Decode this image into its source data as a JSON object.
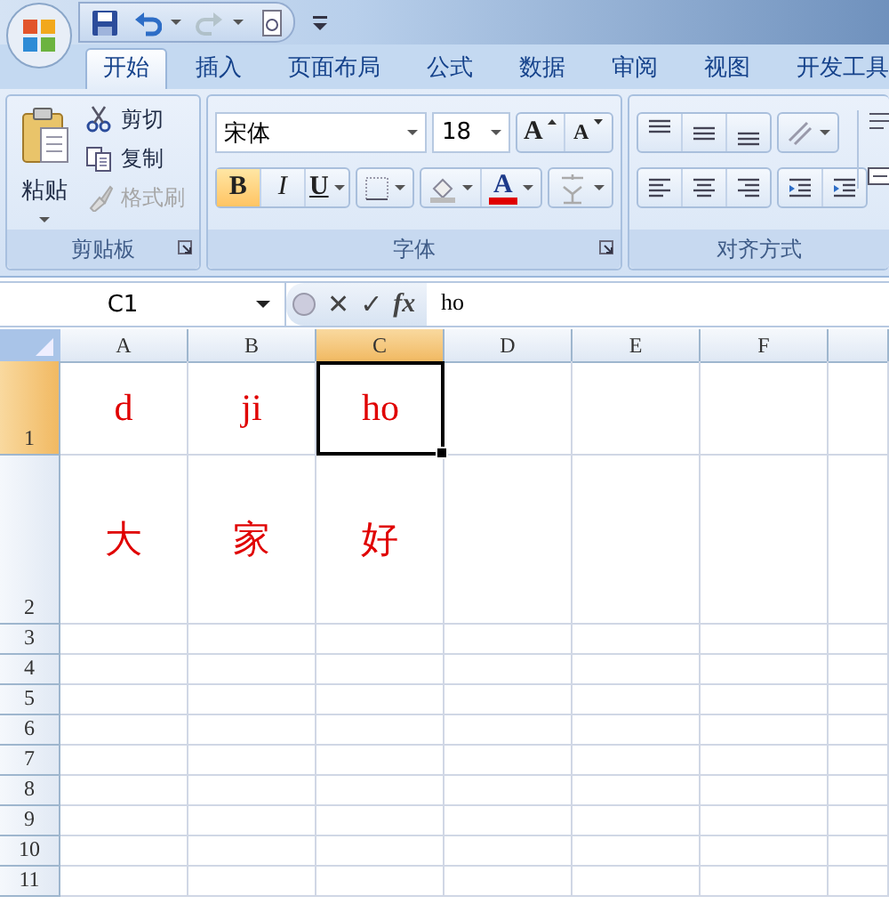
{
  "quick_access": [
    {
      "kind": "save",
      "disabled": false
    },
    {
      "kind": "undo",
      "disabled": false
    },
    {
      "kind": "redo",
      "disabled": true
    },
    {
      "kind": "preview",
      "disabled": false
    }
  ],
  "tabs": [
    {
      "label": "开始",
      "selected": true
    },
    {
      "label": "插入",
      "selected": false
    },
    {
      "label": "页面布局",
      "selected": false
    },
    {
      "label": "公式",
      "selected": false
    },
    {
      "label": "数据",
      "selected": false
    },
    {
      "label": "审阅",
      "selected": false
    },
    {
      "label": "视图",
      "selected": false
    },
    {
      "label": "开发工具",
      "selected": false
    }
  ],
  "clipboard": {
    "label": "剪贴板",
    "paste": "粘贴",
    "commands": [
      {
        "kind": "cut",
        "label": "剪切",
        "disabled": false
      },
      {
        "kind": "copy",
        "label": "复制",
        "disabled": false
      },
      {
        "kind": "brush",
        "label": "格式刷",
        "disabled": true
      }
    ]
  },
  "font": {
    "label": "字体",
    "name": "宋体",
    "size": "18",
    "grow": "A",
    "shrink": "A",
    "styles": [
      {
        "kind": "bold",
        "label": "B",
        "on": true
      },
      {
        "kind": "italic",
        "label": "I",
        "on": false
      },
      {
        "kind": "underline",
        "label": "U",
        "on": false
      }
    ],
    "font_color": "A"
  },
  "alignment": {
    "label": "对齐方式"
  },
  "formula_bar": {
    "name_box": "C1",
    "cancel": "✕",
    "enter": "✓",
    "function": "fx",
    "value": "ho"
  },
  "sheet": {
    "columns": [
      {
        "label": "A",
        "selected": false
      },
      {
        "label": "B",
        "selected": false
      },
      {
        "label": "C",
        "selected": true
      },
      {
        "label": "D",
        "selected": false
      },
      {
        "label": "E",
        "selected": false
      },
      {
        "label": "F",
        "selected": false
      }
    ],
    "rows": [
      {
        "label": "1",
        "selected": true,
        "cells": [
          {
            "text": "d",
            "selected": false
          },
          {
            "text": "ji",
            "selected": false
          },
          {
            "text": "ho",
            "selected": true
          }
        ]
      },
      {
        "label": "2",
        "selected": false,
        "cells": [
          {
            "text": "大",
            "selected": false
          },
          {
            "text": "家",
            "selected": false
          },
          {
            "text": "好",
            "selected": false
          }
        ]
      },
      {
        "label": "3",
        "selected": false,
        "cells": []
      },
      {
        "label": "4",
        "selected": false,
        "cells": []
      },
      {
        "label": "5",
        "selected": false,
        "cells": []
      },
      {
        "label": "6",
        "selected": false,
        "cells": []
      },
      {
        "label": "7",
        "selected": false,
        "cells": []
      },
      {
        "label": "8",
        "selected": false,
        "cells": []
      },
      {
        "label": "9",
        "selected": false,
        "cells": []
      },
      {
        "label": "10",
        "selected": false,
        "cells": []
      },
      {
        "label": "11",
        "selected": false,
        "cells": []
      }
    ]
  }
}
